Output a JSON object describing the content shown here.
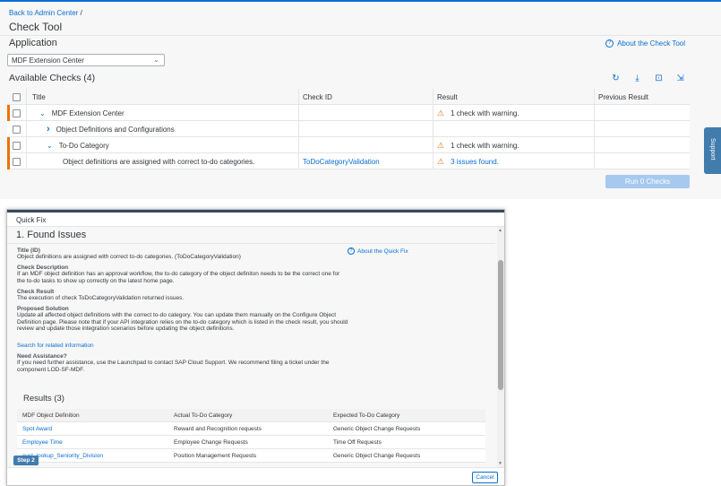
{
  "breadcrumb": {
    "back_label": "Back to Admin Center",
    "separator": "/"
  },
  "page_title": "Check Tool",
  "application": {
    "label": "Application",
    "selected": "MDF Extension Center",
    "about_link": "About the Check Tool"
  },
  "available_checks": {
    "title": "Available Checks (4)",
    "toolbar_icons": [
      "refresh-icon",
      "download-icon",
      "inbox-icon",
      "export-icon"
    ],
    "columns": [
      "Title",
      "Check ID",
      "Result",
      "Previous Result"
    ],
    "rows": [
      {
        "title": "MDF Extension Center",
        "check_id": "",
        "result": "1 check with warning.",
        "previous": "",
        "level": 1,
        "expander": "⌄",
        "warning": true
      },
      {
        "title": "Object Definitions and Configurations",
        "check_id": "",
        "result": "",
        "previous": "",
        "level": 2,
        "expander": "›",
        "warning": false
      },
      {
        "title": "To-Do Category",
        "check_id": "",
        "result": "1 check with warning.",
        "previous": "",
        "level": 2,
        "expander": "⌄",
        "warning": true
      },
      {
        "title": "Object definitions are assigned with correct to-do categories.",
        "check_id": "ToDoCategoryValidation",
        "result": "3 issues found.",
        "previous": "",
        "level": 3,
        "expander": "",
        "warning": true
      }
    ],
    "run_button": "Run 0 Checks"
  },
  "support_tab": "Support",
  "quick_fix": {
    "dialog_title": "Quick Fix",
    "section_title": "1. Found Issues",
    "about_link": "About the Quick Fix",
    "title_label": "Title (ID)",
    "title_value": "Object definitions are assigned with correct to-do categories. (ToDoCategoryValidation)",
    "description_label": "Check Description",
    "description_value": "If an MDF object definition has an approval workflow, the to-do category of the object definiton needs to be the correct one for the to-do tasks to show up correctly on the latest home page.",
    "result_label": "Check Result",
    "result_value": "The execution of check ToDoCategoryValidation returned issues.",
    "solution_label": "Proposed Solution",
    "solution_value": "Update all affected object definitions with the correct to-do category. You can update them manually on the Configure Object Definition page. Please note that if your API integration relies on the to-do category which is listed in the check result, you should review and update those integration scenarios before updating the object definitions.",
    "related_link": "Search for related information",
    "assist_label": "Need Assistance?",
    "assist_value": "If you need further assistance, use the Launchpad to contact SAP Cloud Support. We recommend filing a ticket under the component LOD-SF-MDF.",
    "results_title": "Results (3)",
    "results_columns": [
      "MDF Object Definition",
      "Actual To-Do Category",
      "Expected To-Do Category"
    ],
    "results_rows": [
      {
        "object": "Spot Award",
        "actual": "Reward and Recognition requests",
        "expected": "Generic Object Change Requests"
      },
      {
        "object": "Employee Time",
        "actual": "Employee Change Requests",
        "expected": "Time Off Requests"
      },
      {
        "object": "cust_lookup_Seniority_Division",
        "actual": "Position Management Requests",
        "expected": "Generic Object Change Requests"
      }
    ],
    "step_button": "Step 2",
    "cancel_button": "Cancel"
  },
  "colors": {
    "accent": "#0a6ed1",
    "warning": "#e9730c",
    "disabled_button": "#a6c9ee",
    "emphasized_button": "#427cac"
  }
}
